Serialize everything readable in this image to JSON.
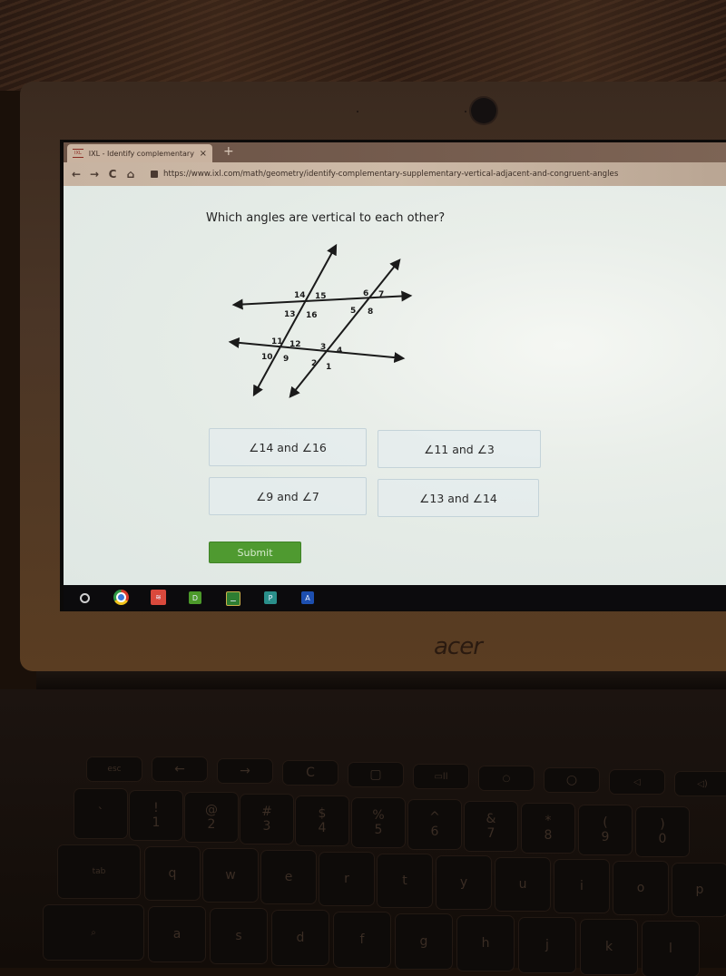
{
  "browser": {
    "tab_title": "IXL - Identify complementary, su",
    "tab_favicon": "IXL",
    "tab_close": "×",
    "new_tab": "+",
    "nav": {
      "back": "←",
      "forward": "→",
      "reload": "C",
      "home": "⌂"
    },
    "url": "https://www.ixl.com/math/geometry/identify-complementary-supplementary-vertical-adjacent-and-congruent-angles"
  },
  "page": {
    "question": "Which angles are vertical to each other?",
    "diagram": {
      "angle_labels": [
        "1",
        "2",
        "3",
        "4",
        "5",
        "6",
        "7",
        "8",
        "9",
        "10",
        "11",
        "12",
        "13",
        "14",
        "15",
        "16"
      ]
    },
    "choices": [
      {
        "label": "∠14 and ∠16"
      },
      {
        "label": "∠11 and ∠3"
      },
      {
        "label": "∠9 and ∠7"
      },
      {
        "label": "∠13 and ∠14"
      }
    ],
    "submit_label": "Submit",
    "colors": {
      "submit": "#4f9a30",
      "choice_border": "#c4d3d9"
    }
  },
  "shelf": {
    "apps": [
      {
        "name": "launcher"
      },
      {
        "name": "chrome"
      },
      {
        "name": "todoist"
      },
      {
        "name": "D",
        "label": "D",
        "color": "#4c9a2a"
      },
      {
        "name": "classroom",
        "label": "⚊",
        "color": "#2e7d32"
      },
      {
        "name": "P",
        "label": "P",
        "color": "#2a8f8a"
      },
      {
        "name": "A",
        "label": "A",
        "color": "#1d4fb0"
      }
    ]
  },
  "device": {
    "brand": "acer"
  },
  "keyboard": {
    "row_top": [
      "esc",
      "←",
      "→",
      "C",
      "▢",
      "▭ll",
      "○",
      "○",
      "◁",
      "◁)"
    ],
    "row_num": [
      "`",
      "!\n1",
      "@\n2",
      "#\n3",
      "$\n4",
      "%\n5",
      "^\n6",
      "&\n7",
      "*\n8",
      "(\n9",
      ")\n0"
    ],
    "row_q": [
      "tab",
      "q",
      "w",
      "e",
      "r",
      "t",
      "y",
      "u",
      "i",
      "o",
      "p"
    ],
    "row_a": [
      "⌕",
      "a",
      "s",
      "d",
      "f",
      "g",
      "h",
      "j",
      "k",
      "l"
    ]
  }
}
